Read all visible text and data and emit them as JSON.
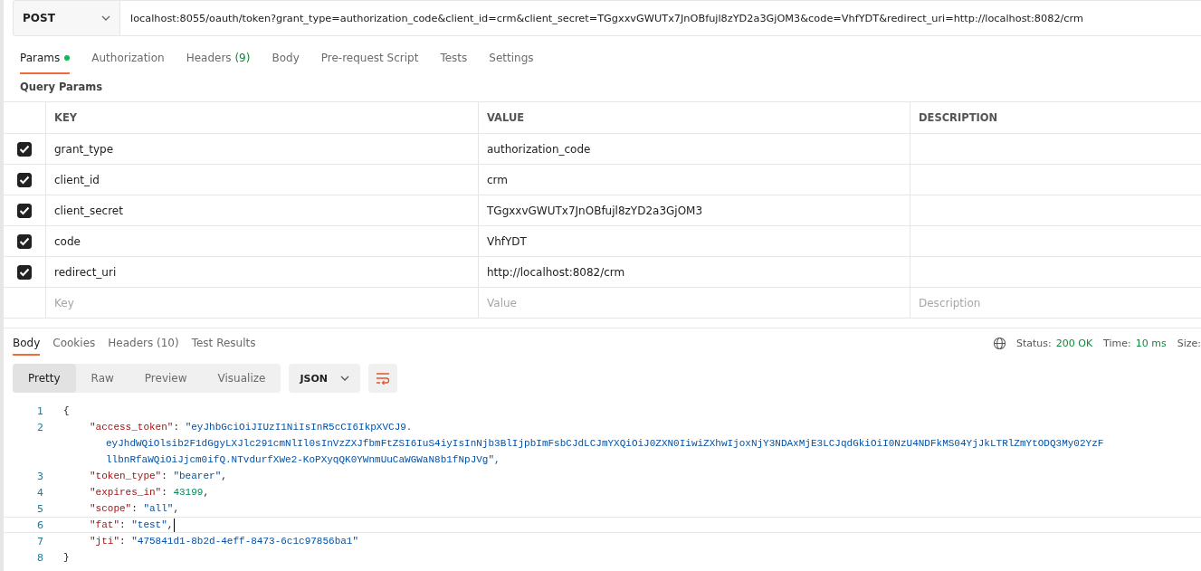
{
  "request": {
    "method": "POST",
    "url": "localhost:8055/oauth/token?grant_type=authorization_code&client_id=crm&client_secret=TGgxxvGWUTx7JnOBfujl8zYD2a3GjOM3&code=VhfYDT&redirect_uri=http://localhost:8082/crm"
  },
  "request_tabs": [
    {
      "label": "Params",
      "dot": true,
      "selected": true
    },
    {
      "label": "Authorization",
      "dot": false,
      "selected": false
    },
    {
      "label": "Headers",
      "count": "(9)",
      "dot": false,
      "selected": false
    },
    {
      "label": "Body",
      "dot": false,
      "selected": false
    },
    {
      "label": "Pre-request Script",
      "dot": false,
      "selected": false
    },
    {
      "label": "Tests",
      "dot": false,
      "selected": false
    },
    {
      "label": "Settings",
      "dot": false,
      "selected": false
    }
  ],
  "query_params": {
    "title": "Query Params",
    "columns": [
      "KEY",
      "VALUE",
      "DESCRIPTION"
    ],
    "rows": [
      {
        "checked": true,
        "key": "grant_type",
        "value": "authorization_code"
      },
      {
        "checked": true,
        "key": "client_id",
        "value": "crm"
      },
      {
        "checked": true,
        "key": "client_secret",
        "value": "TGgxxvGWUTx7JnOBfujl8zYD2a3GjOM3"
      },
      {
        "checked": true,
        "key": "code",
        "value": "VhfYDT"
      },
      {
        "checked": true,
        "key": "redirect_uri",
        "value": "http://localhost:8082/crm"
      }
    ],
    "new_row": {
      "key_placeholder": "Key",
      "value_placeholder": "Value",
      "description_placeholder": "Description"
    }
  },
  "response_tabs": [
    {
      "label": "Body",
      "selected": true
    },
    {
      "label": "Cookies",
      "selected": false
    },
    {
      "label": "Headers",
      "count": "(10)",
      "selected": false
    },
    {
      "label": "Test Results",
      "selected": false
    }
  ],
  "status": {
    "status_label": "Status:",
    "status_value": "200 OK",
    "time_label": "Time:",
    "time_value": "10 ms",
    "size_label": "Size:"
  },
  "view_modes": [
    {
      "label": "Pretty",
      "selected": true
    },
    {
      "label": "Raw",
      "selected": false
    },
    {
      "label": "Preview",
      "selected": false
    },
    {
      "label": "Visualize",
      "selected": false
    }
  ],
  "format": "JSON",
  "code_lines": [
    {
      "number": "1",
      "current": false,
      "tokens": [
        {
          "kind": "punct",
          "text": "{"
        }
      ]
    },
    {
      "number": "2",
      "current": false,
      "tokens": [
        {
          "kind": "key",
          "text": "\"access_token\""
        },
        {
          "kind": "punct",
          "text": ": "
        },
        {
          "kind": "string",
          "text": "\"eyJhbGciOiJIUzI1NiIsInR5cCI6IkpXVCJ9."
        }
      ],
      "continuations": [
        "eyJhdWQiOlsib2F1dGgyLXJlc291cmNlIl0sInVzZXJfbmFtZSI6IuS4iyIsInNjb3BlIjpbImFsbCJdLCJmYXQiOiJ0ZXN0IiwiZXhwIjoxNjY3NDAxMjE3LCJqdGkiOiI0NzU4NDFkMS04YjJkLTRlZmYtODQ3My02YzF",
        "llbnRfaWQiOiJjcm0ifQ.NTvdurfXWe2-KoPXyqQK0YWnmUuCaWGWaN8b1fNpJVg\","
      ]
    },
    {
      "number": "3",
      "current": false,
      "tokens": [
        {
          "kind": "key",
          "text": "\"token_type\""
        },
        {
          "kind": "punct",
          "text": ": "
        },
        {
          "kind": "string",
          "text": "\"bearer\""
        },
        {
          "kind": "punct",
          "text": ","
        }
      ]
    },
    {
      "number": "4",
      "current": false,
      "tokens": [
        {
          "kind": "key",
          "text": "\"expires_in\""
        },
        {
          "kind": "punct",
          "text": ": "
        },
        {
          "kind": "number",
          "text": "43199"
        },
        {
          "kind": "punct",
          "text": ","
        }
      ]
    },
    {
      "number": "5",
      "current": false,
      "tokens": [
        {
          "kind": "key",
          "text": "\"scope\""
        },
        {
          "kind": "punct",
          "text": ": "
        },
        {
          "kind": "string",
          "text": "\"all\""
        },
        {
          "kind": "punct",
          "text": ","
        }
      ]
    },
    {
      "number": "6",
      "current": true,
      "tokens": [
        {
          "kind": "key",
          "text": "\"fat\""
        },
        {
          "kind": "punct",
          "text": ": "
        },
        {
          "kind": "string",
          "text": "\"test\""
        },
        {
          "kind": "punct",
          "text": ","
        }
      ]
    },
    {
      "number": "7",
      "current": false,
      "tokens": [
        {
          "kind": "key",
          "text": "\"jti\""
        },
        {
          "kind": "punct",
          "text": ": "
        },
        {
          "kind": "string",
          "text": "\"475841d1-8b2d-4eff-8473-6c1c97856ba1\""
        }
      ]
    },
    {
      "number": "8",
      "current": false,
      "tokens": [
        {
          "kind": "punct",
          "text": "}"
        }
      ]
    }
  ]
}
